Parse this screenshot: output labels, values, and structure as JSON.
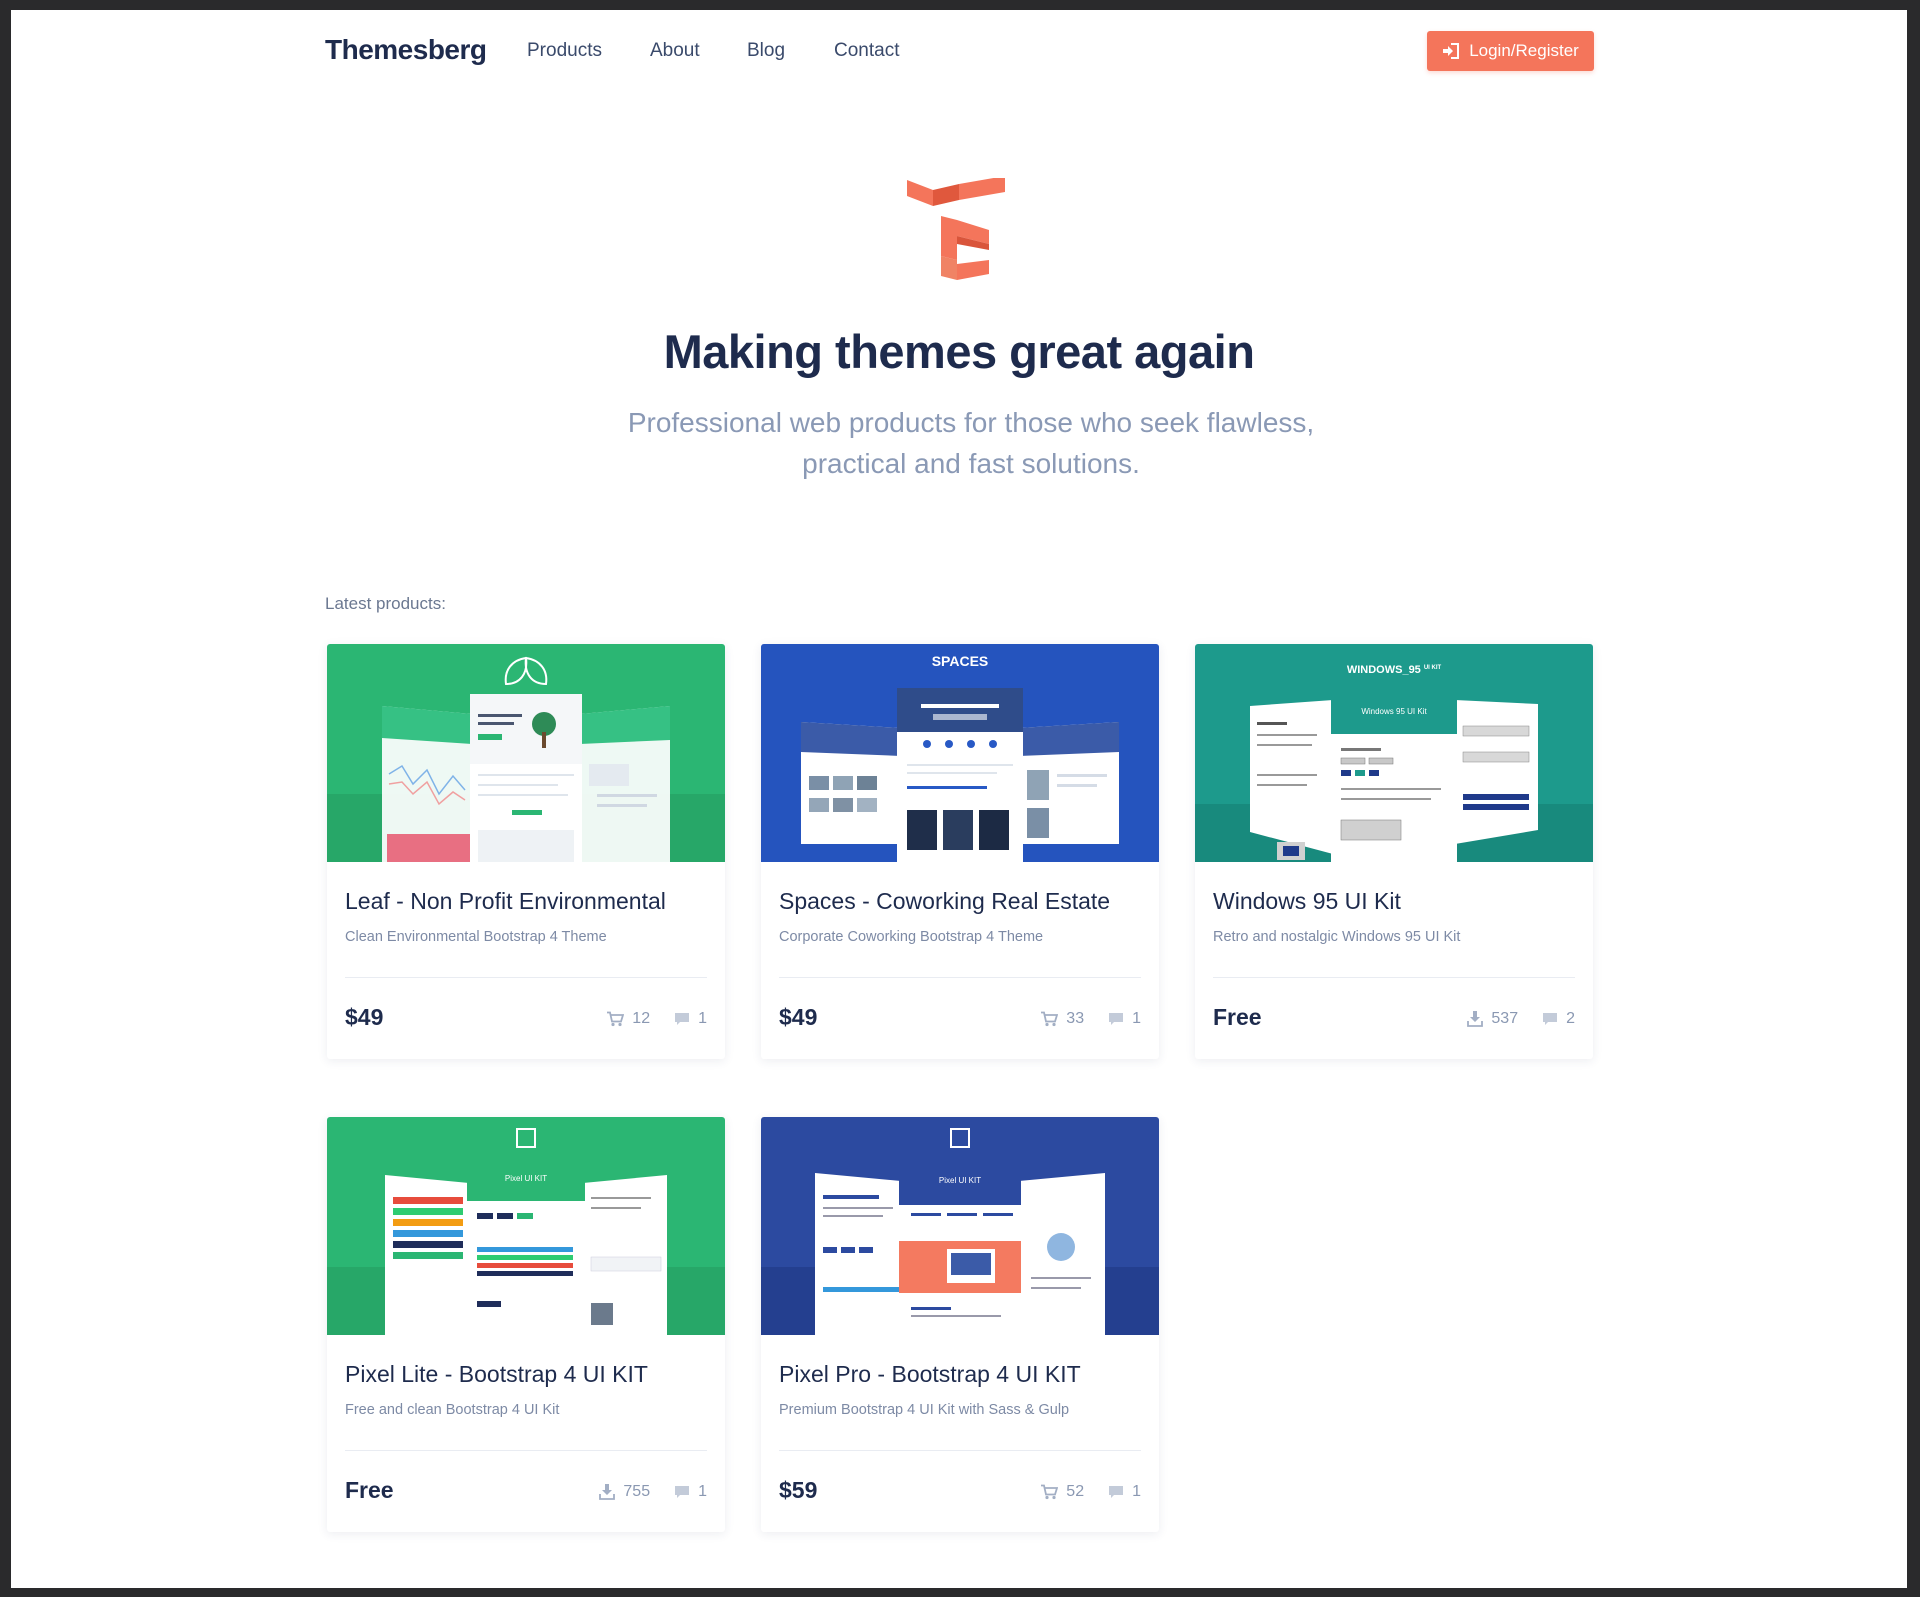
{
  "header": {
    "brand": "Themesberg",
    "nav": [
      "Products",
      "About",
      "Blog",
      "Contact"
    ],
    "login_label": "Login/Register"
  },
  "hero": {
    "title": "Making themes great again",
    "subtitle": "Professional web products for those who seek flawless, practical and fast solutions."
  },
  "section_label": "Latest products:",
  "colors": {
    "accent": "#f4755b",
    "heading": "#1e2b4d",
    "muted": "#8a99b5"
  },
  "products": [
    {
      "title": "Leaf - Non Profit Environmental",
      "subtitle": "Clean Environmental Bootstrap 4 Theme",
      "price": "$49",
      "stat_icon": "cart-icon",
      "stat_count": "12",
      "comments": "1",
      "color": "#2bb673"
    },
    {
      "title": "Spaces - Coworking Real Estate",
      "subtitle": "Corporate Coworking Bootstrap 4 Theme",
      "price": "$49",
      "stat_icon": "cart-icon",
      "stat_count": "33",
      "comments": "1",
      "color": "#2859c5",
      "banner_text": "SPACES"
    },
    {
      "title": "Windows 95 UI Kit",
      "subtitle": "Retro and nostalgic Windows 95 UI Kit",
      "price": "Free",
      "stat_icon": "download-icon",
      "stat_count": "537",
      "comments": "2",
      "color": "#1d9a8c",
      "banner_text": "WINDOWS_95",
      "banner_sup": "UI KIT",
      "panel_text": "Windows 95 UI Kit"
    },
    {
      "title": "Pixel Lite - Bootstrap 4 UI KIT",
      "subtitle": "Free and clean Bootstrap 4 UI Kit",
      "price": "Free",
      "stat_icon": "download-icon",
      "stat_count": "755",
      "comments": "1",
      "color": "#2bb673",
      "panel_text": "Pixel UI KIT"
    },
    {
      "title": "Pixel Pro - Bootstrap 4 UI KIT",
      "subtitle": "Premium Bootstrap 4 UI Kit with Sass & Gulp",
      "price": "$59",
      "stat_icon": "cart-icon",
      "stat_count": "52",
      "comments": "1",
      "color": "#2c4aa0",
      "panel_text": "Pixel UI KIT"
    }
  ]
}
